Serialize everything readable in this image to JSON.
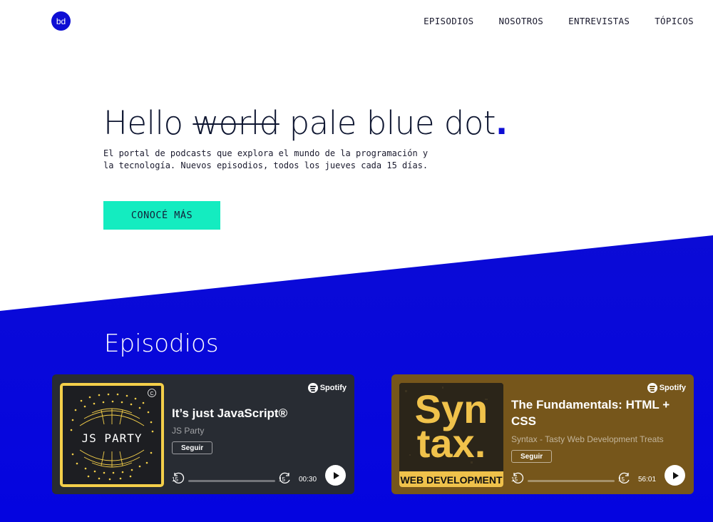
{
  "logo": {
    "text": "bd"
  },
  "nav": [
    "EPISODIOS",
    "NOSOTROS",
    "ENTREVISTAS",
    "TÓPICOS"
  ],
  "hero": {
    "title_start": "Hello",
    "title_struck": "world",
    "title_end": "pale blue dot",
    "title_dot": ".",
    "subtitle_line1": "El portal de podcasts que explora el mundo de la programación y",
    "subtitle_line2": "la tecnología. Nuevos episodios, todos los jueves cada 15 días.",
    "cta_label": "CONOCÉ MÁS"
  },
  "episodes": {
    "title": "Episodios",
    "cards": [
      {
        "cover_text": "JS PARTY",
        "cover_badge": "C",
        "title": "It’s just JavaScript®",
        "show": "JS Party",
        "follow_label": "Seguir",
        "skip_back": "15",
        "skip_fwd": "15",
        "time": "00:30",
        "brand": "Spotify",
        "bg": "#282c33"
      },
      {
        "cover_line1": "Syn",
        "cover_line2": "tax.",
        "cover_banner": "WEB DEVELOPMENT",
        "title_line1": "The Fundamentals: HTML +",
        "title_line2": "CSS",
        "show": "Syntax - Tasty Web Development Treats",
        "follow_label": "Seguir",
        "skip_back": "15",
        "skip_fwd": "15",
        "time": "56:01",
        "brand": "Spotify",
        "bg": "#76561b"
      }
    ]
  },
  "colors": {
    "accent": "#0d0dd4",
    "cta": "#14ecc0"
  }
}
